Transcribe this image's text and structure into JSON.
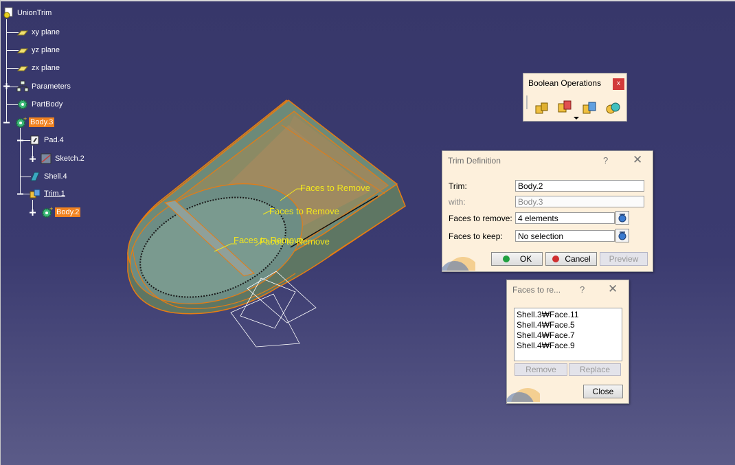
{
  "tree": {
    "root": "UnionTrim",
    "items": [
      {
        "label": "xy plane"
      },
      {
        "label": "yz plane"
      },
      {
        "label": "zx plane"
      },
      {
        "label": "Parameters"
      },
      {
        "label": "PartBody"
      },
      {
        "label": "Body.3"
      },
      {
        "label": "Pad.4"
      },
      {
        "label": "Sketch.2"
      },
      {
        "label": "Shell.4"
      },
      {
        "label": "Trim.1"
      },
      {
        "label": "Body.2"
      }
    ]
  },
  "viewport": {
    "annotations": [
      "Faces to Remove",
      "Faces to Remove",
      "Faces to Remove",
      "Faces to Remove"
    ]
  },
  "boolean_toolbar": {
    "title": "Boolean Operations",
    "close": "x",
    "buttons": [
      "assemble-icon",
      "add-icon",
      "remove-icon",
      "intersect-icon"
    ]
  },
  "trim_dialog": {
    "title": "Trim Definition",
    "help": "?",
    "close": "✕",
    "trim_label": "Trim:",
    "trim_value": "Body.2",
    "with_label": "with:",
    "with_value": "Body.3",
    "remove_label": "Faces to remove:",
    "remove_value": "4 elements",
    "keep_label": "Faces to keep:",
    "keep_value": "No selection",
    "ok": "OK",
    "cancel": "Cancel",
    "preview": "Preview"
  },
  "faces_dialog": {
    "title": "Faces to re...",
    "help": "?",
    "close": "✕",
    "items": [
      "Shell.3₩Face.11",
      "Shell.4₩Face.5",
      "Shell.4₩Face.7",
      "Shell.4₩Face.9"
    ],
    "remove": "Remove",
    "replace": "Replace",
    "close_button": "Close"
  },
  "colors": {
    "background": "#3a3a6e",
    "selection": "#f08220",
    "annotation": "#f2e61e",
    "dialog": "#fdf0dc"
  }
}
